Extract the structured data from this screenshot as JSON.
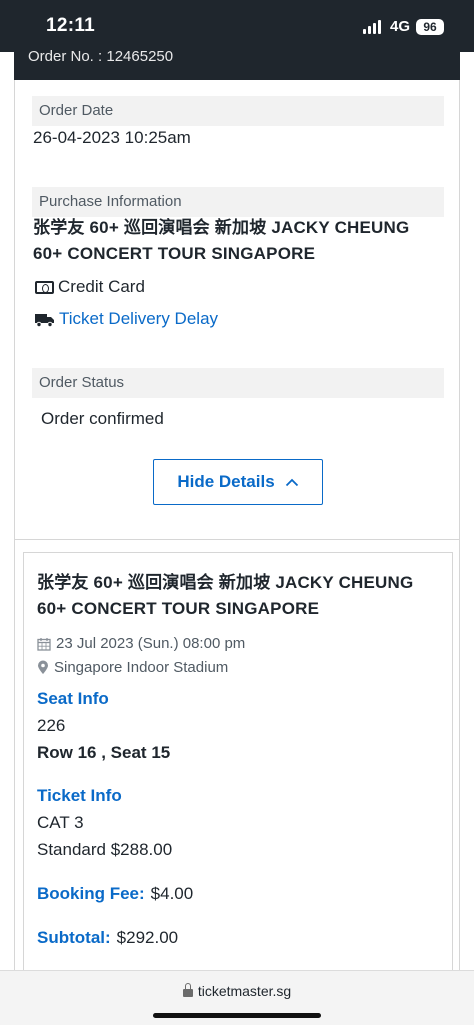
{
  "status_bar": {
    "time": "12:11",
    "network": "4G",
    "battery": "96"
  },
  "order": {
    "number_text": "Order No. : 12465250"
  },
  "details": {
    "order_date_label": "Order Date",
    "order_date_value": "26-04-2023 10:25am",
    "purchase_label": "Purchase Information",
    "purchase_title": "张学友 60+ 巡回演唱会 新加坡 JACKY CHEUNG 60+ CONCERT TOUR SINGAPORE",
    "payment_method": "Credit Card",
    "delivery_link": "Ticket Delivery Delay",
    "status_label": "Order Status",
    "status_value": "Order confirmed",
    "hide_button": "Hide Details"
  },
  "event": {
    "title": "张学友 60+ 巡回演唱会 新加坡 JACKY CHEUNG 60+ CONCERT TOUR SINGAPORE",
    "datetime": "23 Jul 2023 (Sun.) 08:00 pm",
    "venue": "Singapore Indoor Stadium",
    "seat_info_label": "Seat Info",
    "section": "226",
    "row_seat": "Row 16 , Seat 15",
    "ticket_info_label": "Ticket Info",
    "category": "CAT 3",
    "price_line": "Standard $288.00",
    "booking_fee_label": "Booking Fee:",
    "booking_fee_value": "$4.00",
    "subtotal_label": "Subtotal:",
    "subtotal_value": "$292.00"
  },
  "browser": {
    "url": "ticketmaster.sg"
  },
  "colors": {
    "accent": "#0a6ac8",
    "dark": "#1f262d",
    "label_bg": "#f2f2f2"
  }
}
